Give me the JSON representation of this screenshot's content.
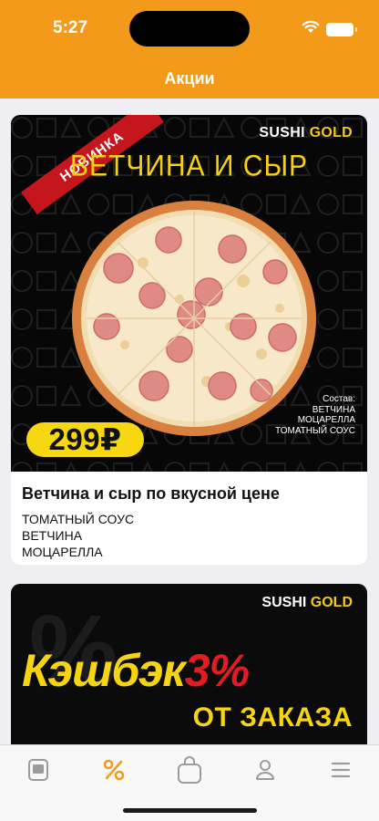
{
  "status_bar": {
    "time": "5:27"
  },
  "header": {
    "title": "Акции"
  },
  "promos": [
    {
      "badge": "НОВИНКА",
      "brand_main": "SUSHI",
      "brand_accent": "GOLD",
      "banner_title": "ВЕТЧИНА И СЫР",
      "price": "299₽",
      "composition_label": "Состав:",
      "composition_items": [
        "ВЕТЧИНА",
        "МОЦАРЕЛЛА",
        "ТОМАТНЫЙ СОУС"
      ],
      "title": "Ветчина и сыр по вкусной цене",
      "ingredients": [
        "ТОМАТНЫЙ СОУС",
        "ВЕТЧИНА",
        "МОЦАРЕЛЛА"
      ]
    },
    {
      "brand_main": "SUSHI",
      "brand_accent": "GOLD",
      "headline_main": "Кэшбэк",
      "headline_accent": "3%",
      "headline_sub": "ОТ ЗАКАЗА"
    }
  ],
  "tabbar": {
    "items": [
      {
        "icon": "menu-card-icon",
        "active": false
      },
      {
        "icon": "percent-icon",
        "active": true
      },
      {
        "icon": "bag-icon",
        "active": false
      },
      {
        "icon": "profile-icon",
        "active": false
      },
      {
        "icon": "hamburger-icon",
        "active": false
      }
    ]
  },
  "colors": {
    "accent": "#f39a1a",
    "badge_red": "#c5161d",
    "promo_yellow": "#f6d712",
    "inactive_tab": "#9b9b9b"
  }
}
